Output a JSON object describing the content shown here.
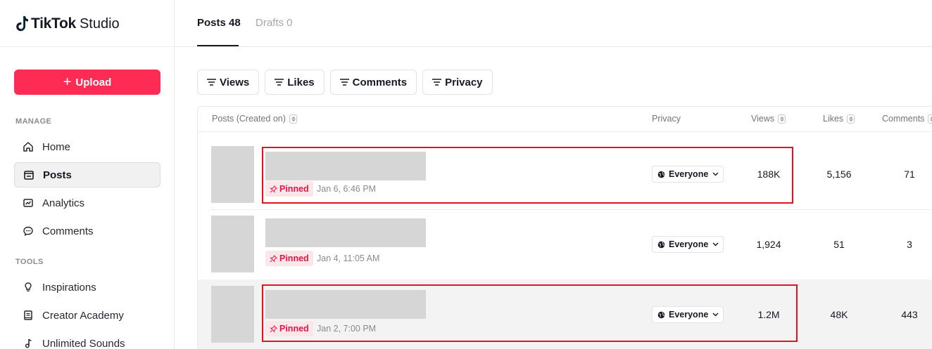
{
  "brand": {
    "name": "TikTok",
    "sub": "Studio"
  },
  "sidebar": {
    "upload_label": "Upload",
    "manage_label": "MANAGE",
    "tools_label": "TOOLS",
    "manage_items": [
      {
        "label": "Home",
        "icon": "home-icon",
        "active": false
      },
      {
        "label": "Posts",
        "icon": "posts-icon",
        "active": true
      },
      {
        "label": "Analytics",
        "icon": "analytics-icon",
        "active": false
      },
      {
        "label": "Comments",
        "icon": "comments-icon",
        "active": false
      }
    ],
    "tools_items": [
      {
        "label": "Inspirations",
        "icon": "lightbulb-icon"
      },
      {
        "label": "Creator Academy",
        "icon": "book-icon"
      },
      {
        "label": "Unlimited Sounds",
        "icon": "music-note-icon"
      }
    ]
  },
  "tabs": {
    "posts": "Posts 48",
    "drafts": "Drafts 0"
  },
  "filters": [
    "Views",
    "Likes",
    "Comments",
    "Privacy"
  ],
  "table": {
    "headers": {
      "posts": "Posts (Created on)",
      "privacy": "Privacy",
      "views": "Views",
      "likes": "Likes",
      "comments": "Comments"
    },
    "rows": [
      {
        "pinned": "Pinned",
        "date": "Jan 6, 6:46 PM",
        "privacy": "Everyone",
        "views": "188K",
        "likes": "5,156",
        "comments": "71"
      },
      {
        "pinned": "Pinned",
        "date": "Jan 4, 11:05 AM",
        "privacy": "Everyone",
        "views": "1,924",
        "likes": "51",
        "comments": "3"
      },
      {
        "pinned": "Pinned",
        "date": "Jan 2, 7:00 PM",
        "privacy": "Everyone",
        "views": "1.2M",
        "likes": "48K",
        "comments": "443"
      }
    ]
  },
  "colors": {
    "accent": "#fe2c55",
    "highlight_box": "#e4121e",
    "pinned_text": "#e0184a"
  }
}
